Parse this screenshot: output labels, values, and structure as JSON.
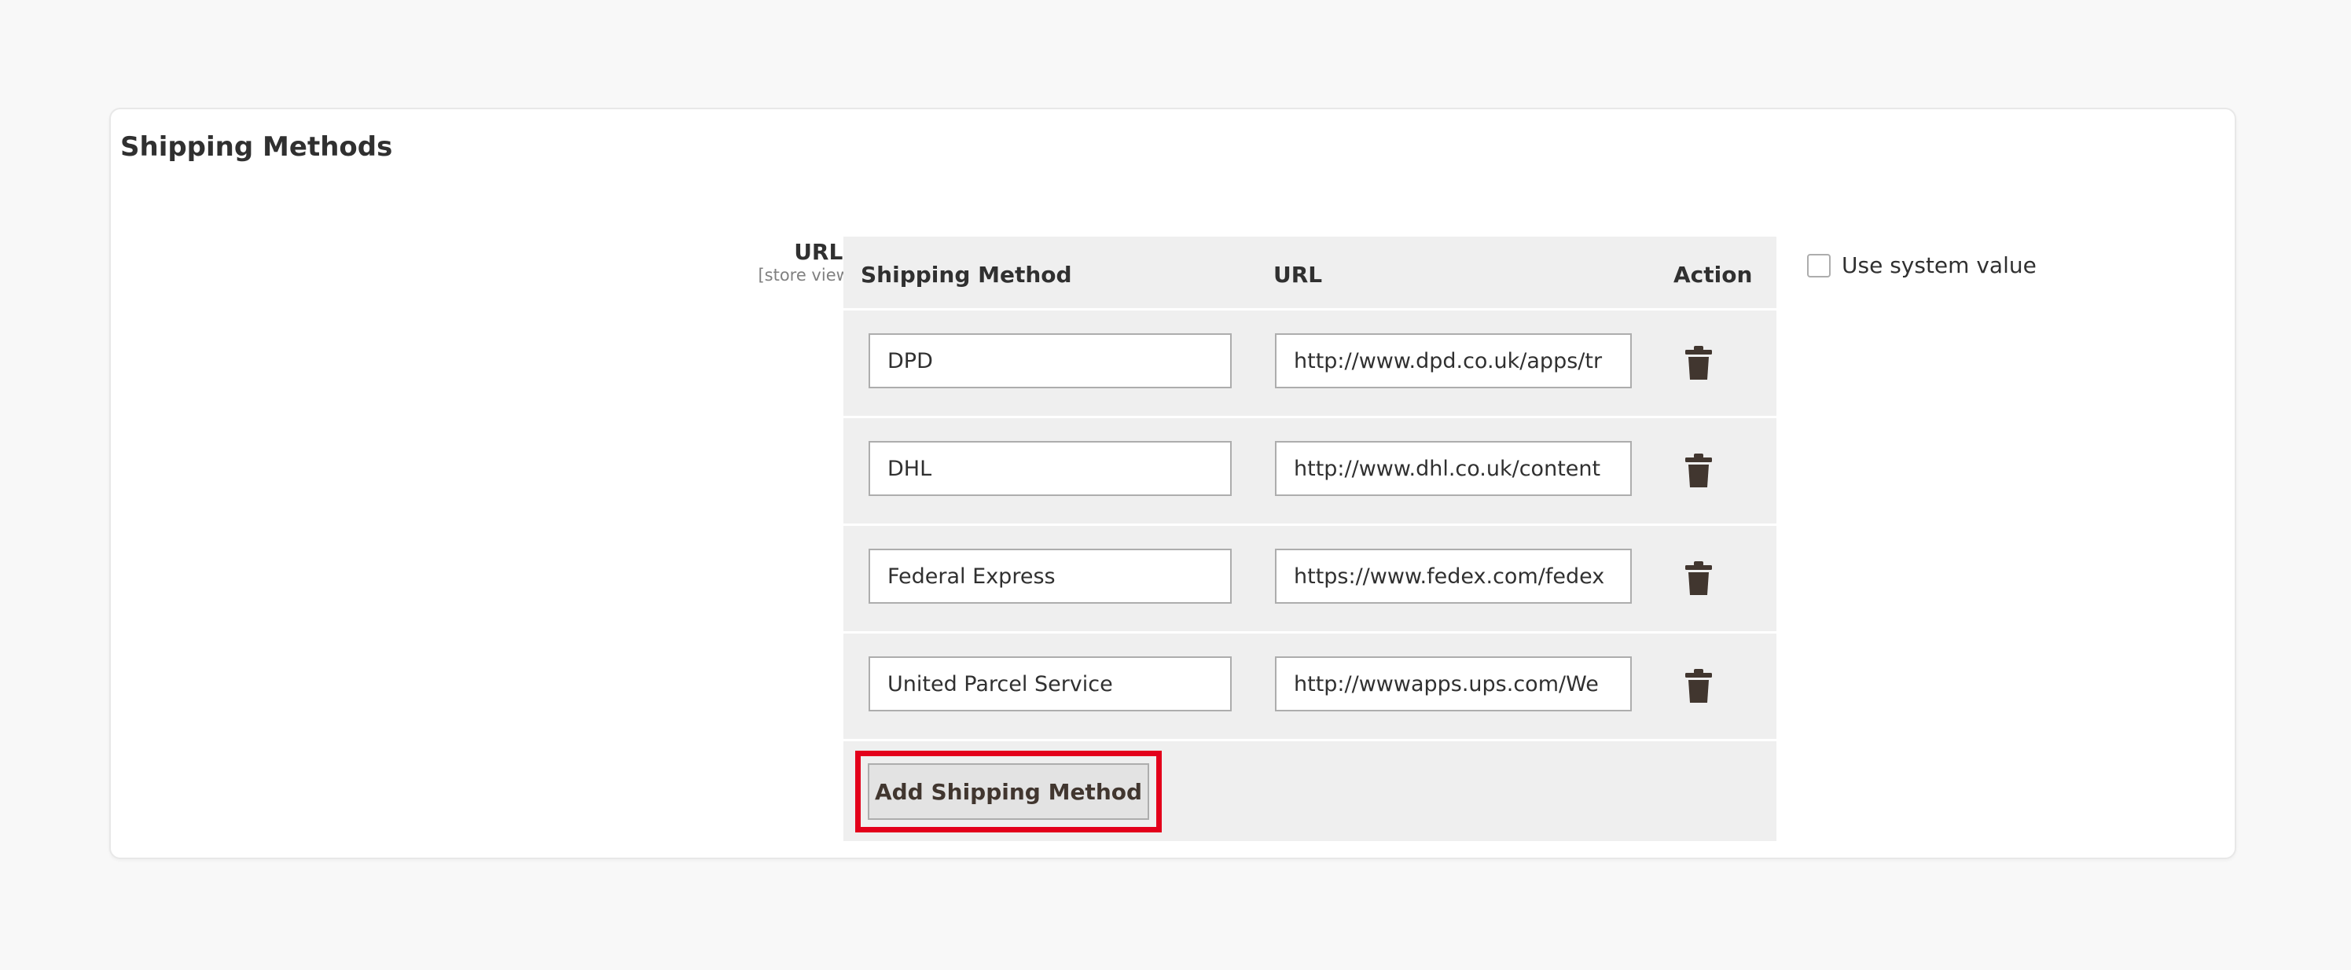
{
  "section": {
    "title": "Shipping Methods"
  },
  "field": {
    "label": "URLs",
    "scope": "[store view]"
  },
  "table": {
    "headers": {
      "method": "Shipping Method",
      "url": "URL",
      "action": "Action"
    },
    "rows": [
      {
        "method": "DPD",
        "url": "http://www.dpd.co.uk/apps/tr"
      },
      {
        "method": "DHL",
        "url": "http://www.dhl.co.uk/content"
      },
      {
        "method": "Federal Express",
        "url": "https://www.fedex.com/fedex"
      },
      {
        "method": "United Parcel Service",
        "url": "http://wwwapps.ups.com/We"
      }
    ],
    "row_action_icon": "trash-icon",
    "add_button_label": "Add Shipping Method"
  },
  "system_value": {
    "label": "Use system value",
    "checked": false
  },
  "colors": {
    "highlight": "#e3001b",
    "grid_bg": "#efefef",
    "button_text": "#41362f"
  }
}
